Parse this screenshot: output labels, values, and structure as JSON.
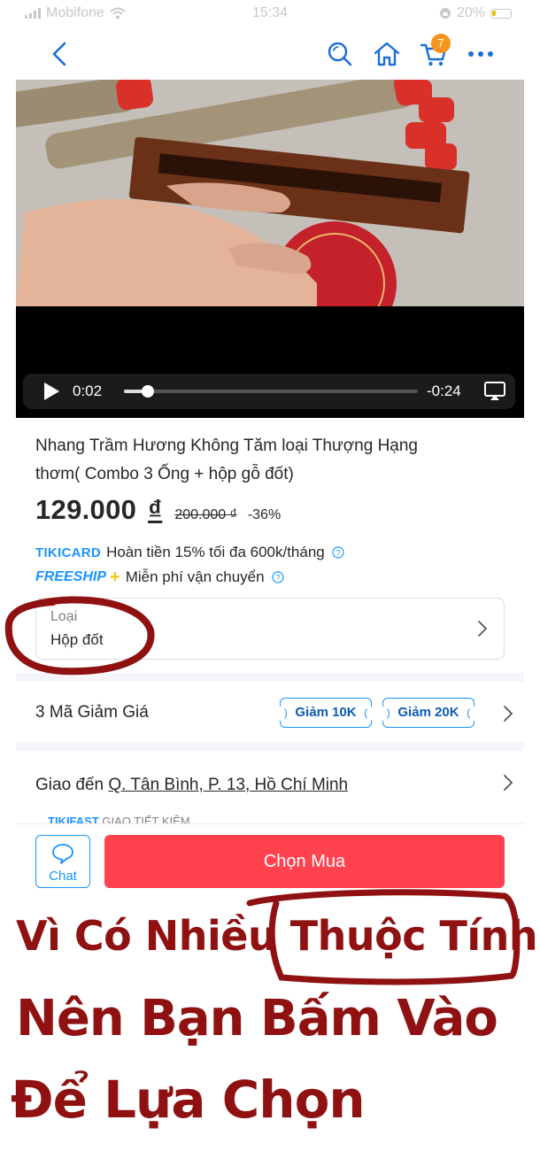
{
  "status_bar": {
    "carrier": "Mobifone",
    "time": "15:34",
    "battery": "20%"
  },
  "nav": {
    "cart_count": "7",
    "icons": [
      "back-arrow-icon",
      "search-icon",
      "home-icon",
      "cart-icon",
      "more-icon"
    ]
  },
  "video": {
    "current_time": "0:02",
    "remaining_time": "-0:24",
    "progress": 0.08
  },
  "product": {
    "title_line1": "Nhang Trầm Hương Không Tăm loại Thượng Hạng",
    "title_line2": "thơm( Combo 3 Ống + hộp gỗ đốt)",
    "price": "129.000",
    "currency": "₫",
    "old_price": "200.000 ₫",
    "discount": "-36%"
  },
  "promos": {
    "tikicard_logo": "TIKICARD",
    "tikicard_text": "Hoàn tiền 15% tối đa 600k/tháng",
    "freeship_logo": "FREESHIP",
    "freeship_plus": "+",
    "freeship_text": "Miễn phí vận chuyển"
  },
  "variant": {
    "label": "Loại",
    "value": "Hộp đốt"
  },
  "coupons": {
    "label": "3 Mã Giảm Giá",
    "items": [
      "Giảm 10K",
      "Giảm 20K"
    ]
  },
  "delivery": {
    "prefix": "Giao đến ",
    "address": "Q. Tân Bình, P. 13, Hồ Chí Minh",
    "sub_logo": "TIKIFAST",
    "sub_text": "GIAO TIẾT KIỆM"
  },
  "bottom_bar": {
    "chat_label": "Chat",
    "buy_label": "Chọn Mua"
  },
  "annotation": {
    "line1_pre": "Vì Có Nhiều ",
    "line1_highlight": "Thuộc Tính",
    "line2": "Nên Bạn Bấm Vào",
    "line3": "Để Lựa Chọn"
  },
  "colors": {
    "accent": "#1a94ff",
    "buy_button": "#ff424e",
    "cart_badge": "#f7941d",
    "annotation": "#8f1111"
  }
}
